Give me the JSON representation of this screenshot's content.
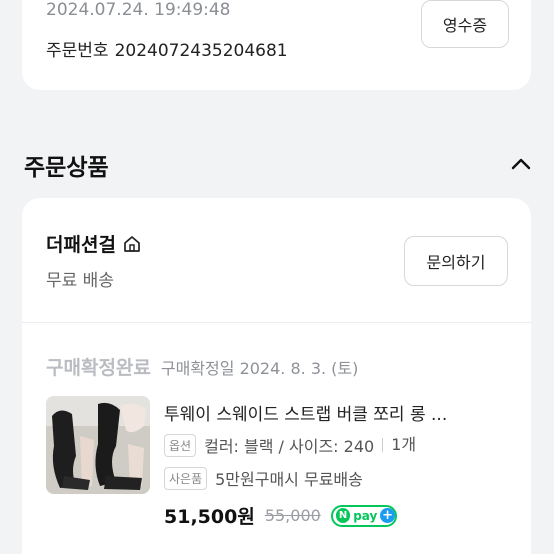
{
  "order": {
    "date": "2024.07.24. 19:49:48",
    "number_label": "주문번호",
    "number": "2024072435204681",
    "receipt_label": "영수증"
  },
  "section": {
    "title": "주문상품"
  },
  "shop": {
    "name": "더패션걸",
    "shipping": "무료 배송",
    "inquiry_label": "문의하기"
  },
  "item": {
    "status": "구매확정완료",
    "status_date": "구매확정일 2024. 8. 3. (토)",
    "name": "투웨이 스웨이드 스트랩 버클 쪼리 롱 ...",
    "option_tag": "옵션",
    "option_text": "컬러: 블랙 / 사이즈: 240",
    "quantity": "1개",
    "gift_tag": "사은품",
    "gift_text": "5만원구매시 무료배송",
    "price": "51,500원",
    "original_price": "55,000",
    "npay_label": "pay",
    "npay_n": "N",
    "npay_plus": "+"
  },
  "icons": {
    "shop": "home-icon",
    "collapse": "chevron-up-icon"
  }
}
